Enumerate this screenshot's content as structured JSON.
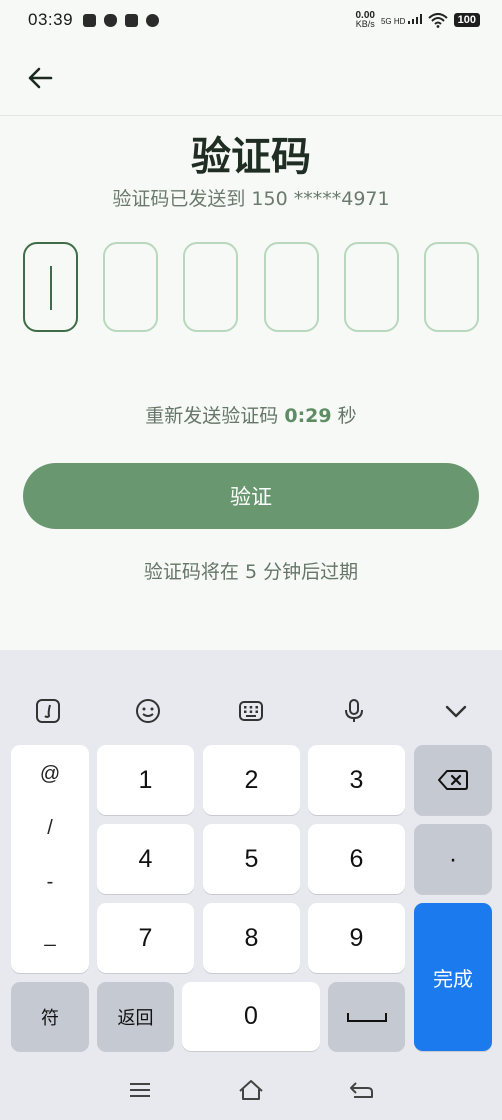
{
  "status_bar": {
    "time": "03:39",
    "net_speed_value": "0.00",
    "net_speed_unit": "KB/s",
    "network": "5G HD",
    "battery": "100"
  },
  "header": {
    "back_icon": "arrow-left-icon"
  },
  "title": "验证码",
  "subtitle": "验证码已发送到 150 *****4971",
  "code_boxes": [
    "",
    "",
    "",
    "",
    "",
    ""
  ],
  "resend": {
    "label": "重新发送验证码",
    "timer": "0:29",
    "unit": "秒"
  },
  "verify_button": "验证",
  "expire_note": "验证码将在 5 分钟后过期",
  "keyboard": {
    "toolbar": [
      "handwriting-icon",
      "emoji-icon",
      "keyboard-icon",
      "microphone-icon",
      "chevron-down-icon"
    ],
    "symbols": [
      "@",
      "/",
      "-",
      "_"
    ],
    "keys": {
      "k1": "1",
      "k2": "2",
      "k3": "3",
      "k4": "4",
      "k5": "5",
      "k6": "6",
      "k7": "7",
      "k8": "8",
      "k9": "9",
      "k0": "0",
      "dot": "·"
    },
    "fu": "符",
    "back": "返回",
    "done": "完成",
    "backspace_icon": "backspace-icon",
    "space_icon": "space-icon"
  },
  "nav": [
    "menu-icon",
    "home-icon",
    "back-icon"
  ],
  "colors": {
    "accent": "#699870",
    "done_blue": "#1a7aee",
    "box_border": "#b9d7bd",
    "active_border": "#3f6d47"
  }
}
